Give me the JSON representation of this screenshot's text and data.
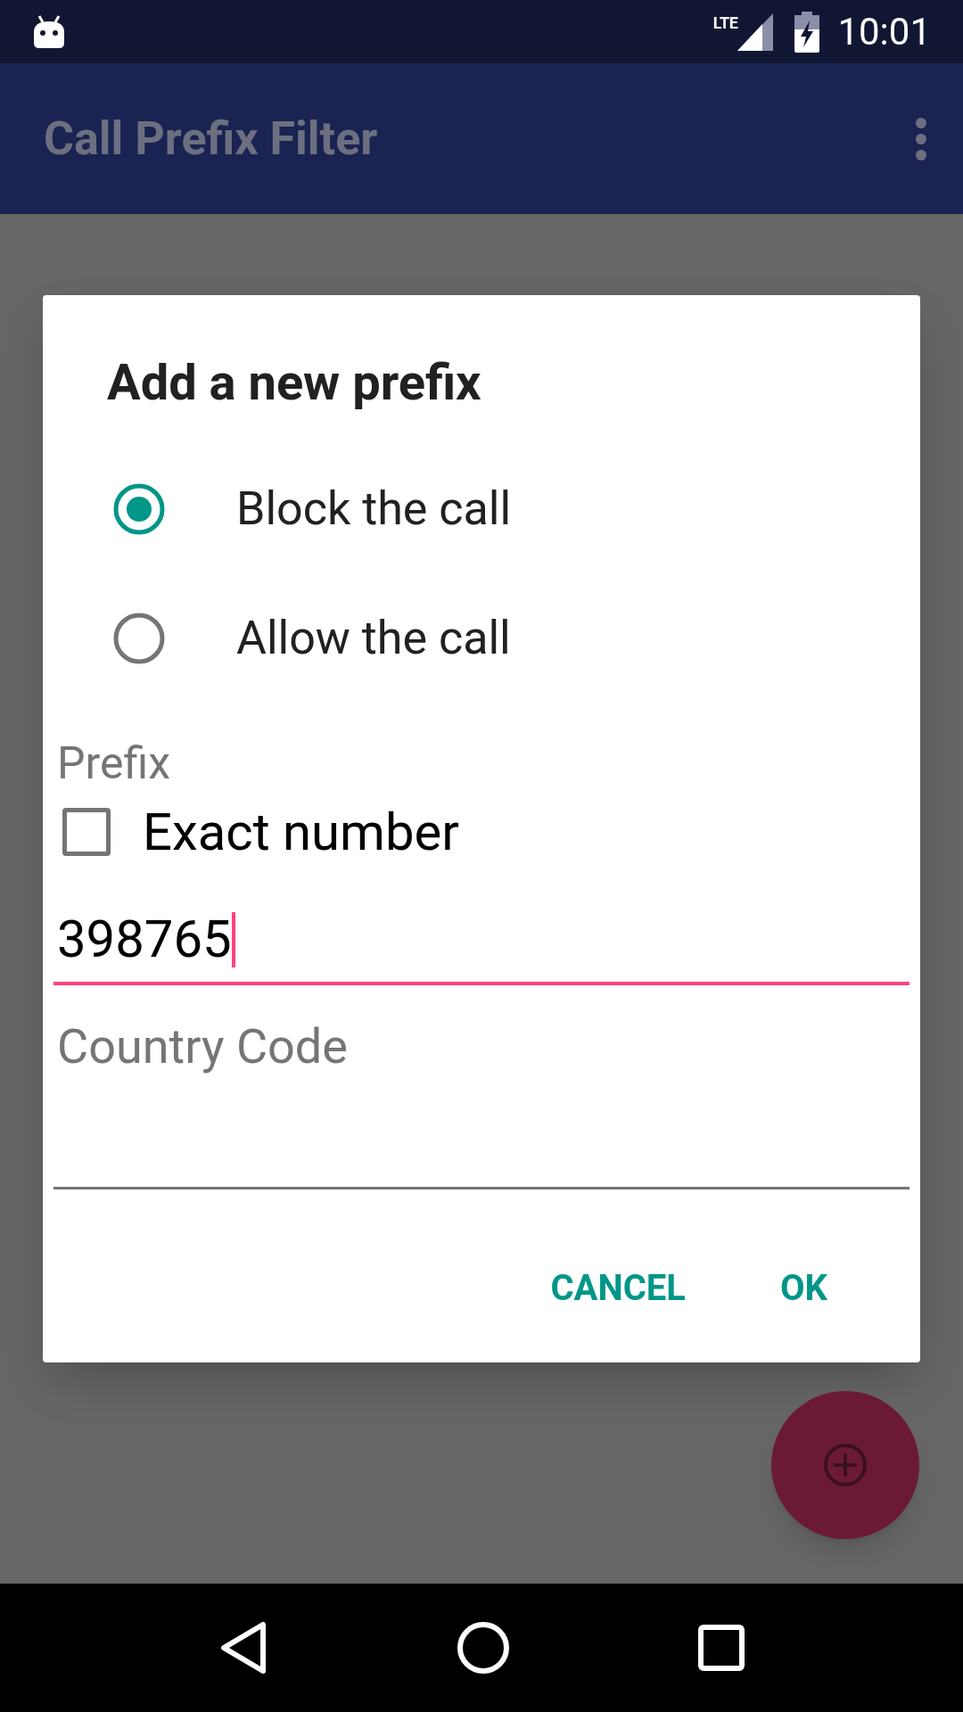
{
  "status_bar": {
    "network": "LTE",
    "time": "10:01"
  },
  "app_bar": {
    "title": "Call Prefix Filter"
  },
  "dialog": {
    "title": "Add a new prefix",
    "options": [
      {
        "label": "Block the call",
        "selected": true
      },
      {
        "label": "Allow the call",
        "selected": false
      }
    ],
    "prefix_label": "Prefix",
    "exact_number": {
      "label": "Exact number",
      "checked": false
    },
    "prefix_field": {
      "value": "398765",
      "focused": true
    },
    "country_code_label": "Country Code",
    "buttons": [
      "CANCEL",
      "OK"
    ]
  }
}
